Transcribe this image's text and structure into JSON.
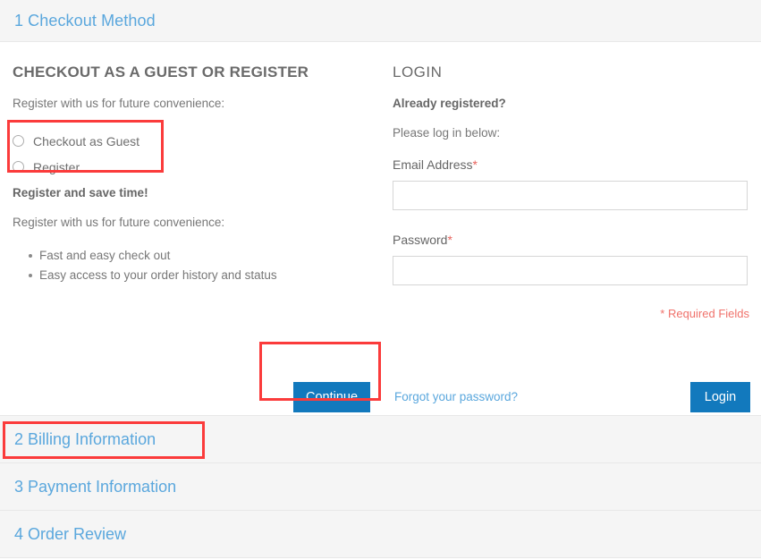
{
  "steps": [
    {
      "number": "1",
      "title": "Checkout Method",
      "state": "active"
    },
    {
      "number": "2",
      "title": "Billing Information",
      "state": "collapsed"
    },
    {
      "number": "3",
      "title": "Payment Information",
      "state": "collapsed"
    },
    {
      "number": "4",
      "title": "Order Review",
      "state": "collapsed"
    }
  ],
  "guest": {
    "heading": "CHECKOUT AS A GUEST OR REGISTER",
    "intro": "Register with us for future convenience:",
    "options": [
      {
        "label": "Checkout as Guest",
        "selected": false
      },
      {
        "label": "Register",
        "selected": false
      }
    ],
    "register_heading": "Register and save time!",
    "register_intro": "Register with us for future convenience:",
    "benefits": [
      "Fast and easy check out",
      "Easy access to your order history and status"
    ],
    "continue_label": "Continue"
  },
  "login": {
    "heading": "LOGIN",
    "already_registered": "Already registered?",
    "please_log_in": "Please log in below:",
    "email_label": "Email Address",
    "email_value": "",
    "email_placeholder": "",
    "password_label": "Password",
    "password_value": "",
    "password_placeholder": "",
    "required_marker": "*",
    "required_note": "* Required Fields",
    "forgot_link": "Forgot your password?",
    "login_label": "Login"
  },
  "colors": {
    "step_link": "#5aa7dd",
    "button_blue": "#1279bd",
    "required_red": "#f0726b",
    "highlight_red": "#fb3b3b",
    "step_bg": "#f5f5f5"
  }
}
